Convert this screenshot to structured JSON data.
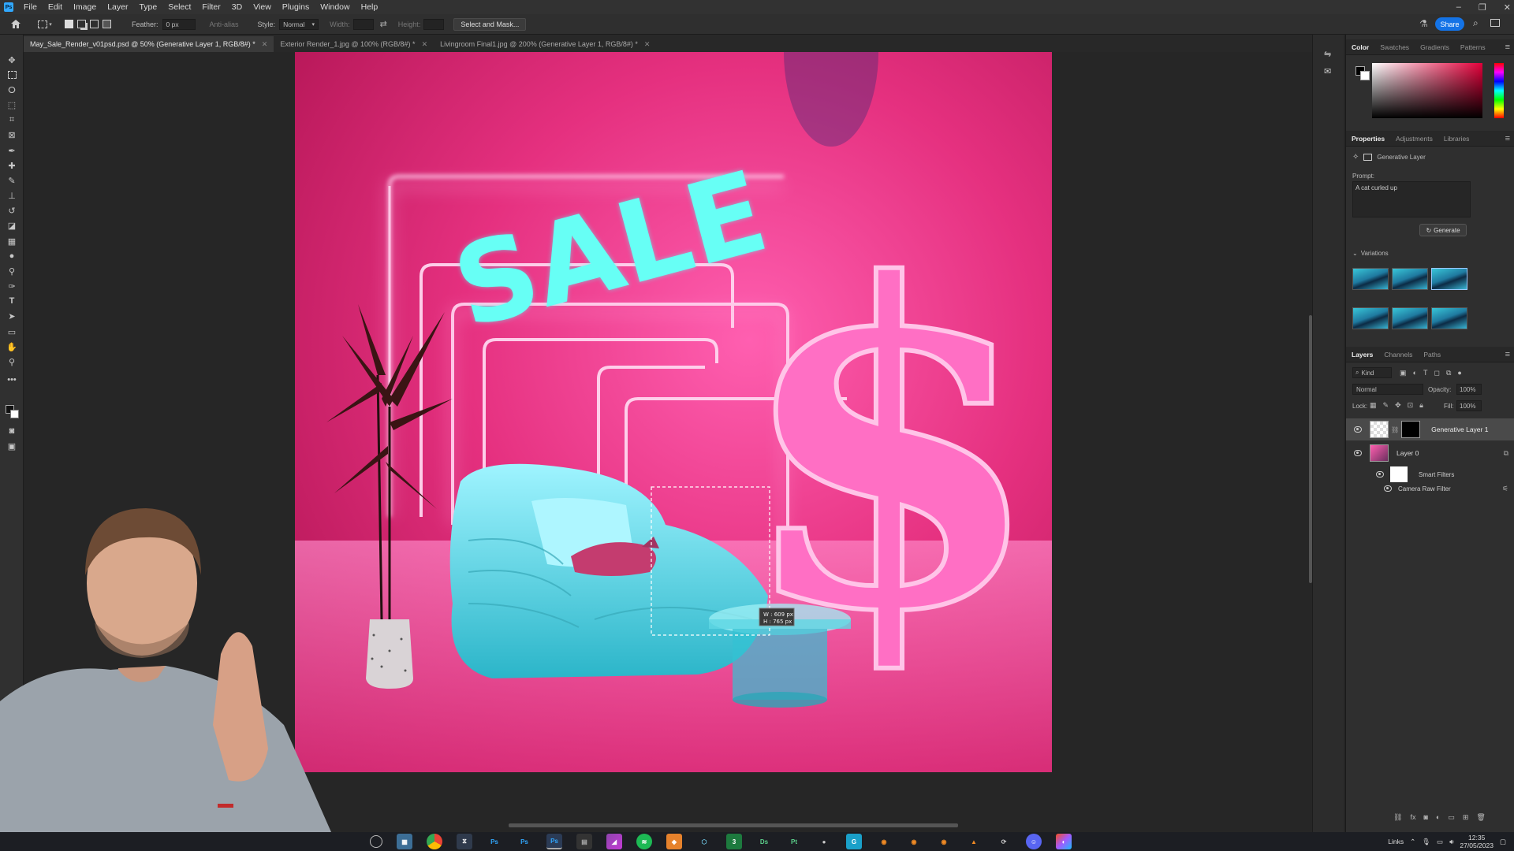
{
  "menu": {
    "items": [
      "File",
      "Edit",
      "Image",
      "Layer",
      "Type",
      "Select",
      "Filter",
      "3D",
      "View",
      "Plugins",
      "Window",
      "Help"
    ]
  },
  "options": {
    "feather_label": "Feather:",
    "feather_value": "0 px",
    "antialias_label": "Anti-alias",
    "style_label": "Style:",
    "style_value": "Normal",
    "width_label": "Width:",
    "height_label": "Height:",
    "select_mask_label": "Select and Mask...",
    "share_label": "Share"
  },
  "tabs": [
    {
      "label": "May_Sale_Render_v01psd.psd @ 50% (Generative Layer 1, RGB/8#) *",
      "active": true
    },
    {
      "label": "Exterior Render_1.jpg @ 100% (RGB/8#) *",
      "active": false
    },
    {
      "label": "Livingroom Final1.jpg @ 200% (Generative Layer 1, RGB/8#) *",
      "active": false
    }
  ],
  "canvas": {
    "sale_text": "SALE",
    "dollar_text": "$",
    "selection_w": "W : 609 px",
    "selection_h": "H : 765 px"
  },
  "color_panel": {
    "tabs": [
      "Color",
      "Swatches",
      "Gradients",
      "Patterns"
    ],
    "active_tab": "Color",
    "accent": "#e3003a"
  },
  "properties": {
    "tabs": [
      "Properties",
      "Adjustments",
      "Libraries"
    ],
    "layer_type": "Generative Layer",
    "prompt_label": "Prompt:",
    "prompt_value": "A cat curled up",
    "generate_label": "Generate",
    "variations_label": "Variations"
  },
  "layers": {
    "tabs": [
      "Layers",
      "Channels",
      "Paths"
    ],
    "kind_label": "Kind",
    "blend_mode": "Normal",
    "opacity_label": "Opacity:",
    "opacity_value": "100%",
    "lock_label": "Lock:",
    "fill_label": "Fill:",
    "fill_value": "100%",
    "items": [
      {
        "name": "Generative Layer 1",
        "selected": true
      },
      {
        "name": "Layer 0",
        "selected": false
      },
      {
        "name": "Smart Filters",
        "selected": false
      },
      {
        "name": "Camera Raw Filter",
        "selected": false
      }
    ]
  },
  "taskbar": {
    "apps": [
      "settings",
      "calculator",
      "chrome",
      "chrome-dev",
      "Ps",
      "Ps",
      "Ps",
      "files",
      "affinity",
      "spotify",
      "sublime",
      "blender-cycle",
      "excel",
      "Ds",
      "Pt",
      "obs",
      "cinema",
      "blender",
      "blender-2",
      "blender-3",
      "vlc",
      "sync",
      "discord",
      "figma"
    ],
    "links_label": "Links",
    "time": "12:35",
    "date": "27/05/2023"
  }
}
